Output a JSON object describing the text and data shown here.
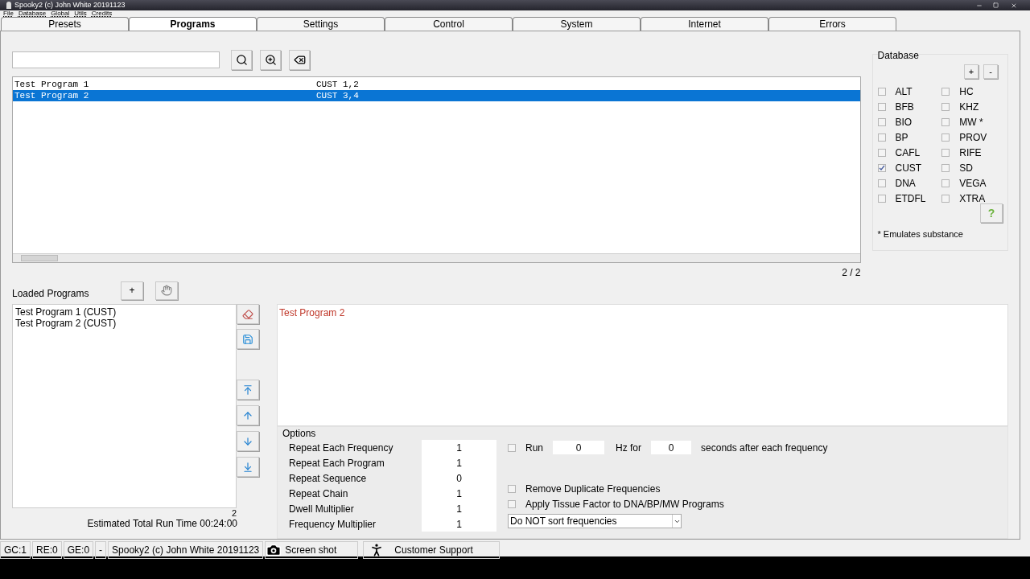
{
  "window": {
    "title": "Spooky2 (c) John White 20191123"
  },
  "menu": [
    "File",
    "Database",
    "Global",
    "Utils",
    "Credits"
  ],
  "tabs": [
    {
      "label": "Presets",
      "selected": false
    },
    {
      "label": "Programs",
      "selected": true
    },
    {
      "label": "Settings",
      "selected": false
    },
    {
      "label": "Control",
      "selected": false
    },
    {
      "label": "System",
      "selected": false
    },
    {
      "label": "Internet",
      "selected": false
    },
    {
      "label": "Errors",
      "selected": false
    }
  ],
  "programs": [
    {
      "name": "Test Program 1",
      "code": "CUST 1,2",
      "selected": false
    },
    {
      "name": "Test Program 2",
      "code": "CUST 3,4",
      "selected": true
    }
  ],
  "program_count": "2 / 2",
  "database": {
    "title": "Database",
    "buttons": [
      "+",
      "-"
    ],
    "items": [
      {
        "label": "ALT",
        "checked": false
      },
      {
        "label": "BFB",
        "checked": false
      },
      {
        "label": "BIO",
        "checked": false
      },
      {
        "label": "BP",
        "checked": false
      },
      {
        "label": "CAFL",
        "checked": false
      },
      {
        "label": "CUST",
        "checked": true
      },
      {
        "label": "DNA",
        "checked": false
      },
      {
        "label": "ETDFL",
        "checked": false
      },
      {
        "label": "HC",
        "checked": false
      },
      {
        "label": "KHZ",
        "checked": false
      },
      {
        "label": "MW *",
        "checked": false
      },
      {
        "label": "PROV",
        "checked": false
      },
      {
        "label": "RIFE",
        "checked": false
      },
      {
        "label": "SD",
        "checked": false
      },
      {
        "label": "VEGA",
        "checked": false
      },
      {
        "label": "XTRA",
        "checked": false
      }
    ],
    "help": "?",
    "footnote": "* Emulates substance"
  },
  "loaded": {
    "title": "Loaded Programs",
    "add": "+",
    "items": [
      "Test Program 1 (CUST)",
      "Test Program 2 (CUST)"
    ]
  },
  "detail": {
    "title": "Test Program 2"
  },
  "options": {
    "title": "Options",
    "rows": [
      {
        "label": "Repeat Each Frequency",
        "value": "1"
      },
      {
        "label": "Repeat Each Program",
        "value": "1"
      },
      {
        "label": "Repeat Sequence",
        "value": "0"
      },
      {
        "label": "Repeat Chain",
        "value": "1"
      },
      {
        "label": "Dwell Multiplier",
        "value": "1"
      },
      {
        "label": "Frequency Multiplier",
        "value": "1"
      }
    ],
    "run": {
      "checked": false,
      "label": "Run",
      "hz": "0",
      "hz_label": "Hz for",
      "seconds": "0",
      "suffix": "seconds after each frequency"
    },
    "checkboxes": [
      {
        "label": "Remove Duplicate Frequencies",
        "checked": false
      },
      {
        "label": "Apply Tissue Factor to DNA/BP/MW Programs",
        "checked": false
      }
    ],
    "sort": "Do NOT sort frequencies"
  },
  "loaded_count": "2",
  "run_time": "Estimated Total Run Time 00:24:00",
  "status_bar": {
    "cells": [
      "GC:1",
      "RE:0",
      "GE:0",
      "-",
      "Spooky2 (c) John White 20191123"
    ],
    "screenshot": "Screen shot",
    "support": "Customer Support"
  }
}
